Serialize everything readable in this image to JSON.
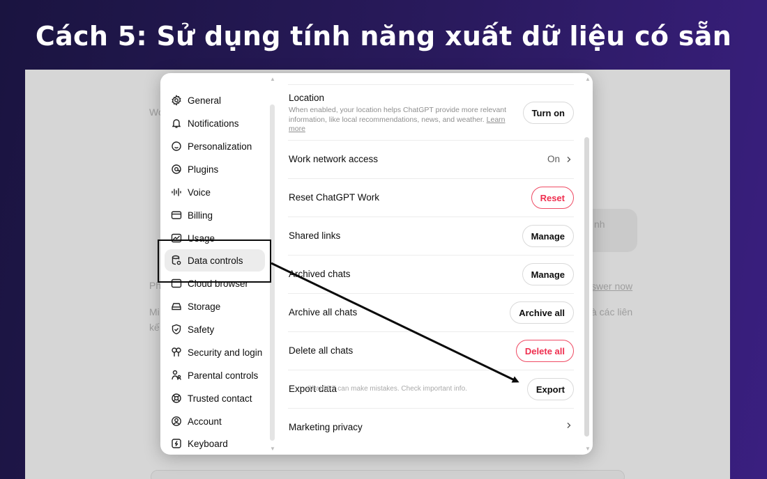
{
  "banner": {
    "title": "Cách 5: Sử dụng tính năng xuất dữ liệu có sẵn"
  },
  "background": {
    "frag_wo": "Wo",
    "frag_ph": "Ph",
    "frag_nh": "nh",
    "frag_answer": "swer now",
    "frag_lien": "à các liên",
    "frag_m": "Mi",
    "frag_ke": "kế",
    "footer_note": "ChatGPT can make mistakes. Check important info."
  },
  "sidebar": {
    "items": [
      {
        "label": "General",
        "icon": "gear-icon"
      },
      {
        "label": "Notifications",
        "icon": "bell-icon"
      },
      {
        "label": "Personalization",
        "icon": "personalization-icon"
      },
      {
        "label": "Plugins",
        "icon": "plugins-icon"
      },
      {
        "label": "Voice",
        "icon": "waveform-icon"
      },
      {
        "label": "Billing",
        "icon": "card-icon"
      },
      {
        "label": "Usage",
        "icon": "usage-chart-icon"
      },
      {
        "label": "Data controls",
        "icon": "database-icon"
      },
      {
        "label": "Cloud browser",
        "icon": "cloud-browser-icon"
      },
      {
        "label": "Storage",
        "icon": "storage-icon"
      },
      {
        "label": "Safety",
        "icon": "shield-icon"
      },
      {
        "label": "Security and login",
        "icon": "key-icon"
      },
      {
        "label": "Parental controls",
        "icon": "parental-icon"
      },
      {
        "label": "Trusted contact",
        "icon": "lifebuoy-icon"
      },
      {
        "label": "Account",
        "icon": "account-icon"
      },
      {
        "label": "Keyboard",
        "icon": "keyboard-icon"
      }
    ],
    "active_item": "Data controls"
  },
  "settings": {
    "location": {
      "label": "Location",
      "description": "When enabled, your location helps ChatGPT provide more relevant information, like local recommendations, news, and weather.",
      "learn_more": "Learn more",
      "button": "Turn on"
    },
    "work_network": {
      "label": "Work network access",
      "value": "On"
    },
    "reset_work": {
      "label": "Reset ChatGPT Work",
      "button": "Reset"
    },
    "shared_links": {
      "label": "Shared links",
      "button": "Manage"
    },
    "archived_chats": {
      "label": "Archived chats",
      "button": "Manage"
    },
    "archive_all": {
      "label": "Archive all chats",
      "button": "Archive all"
    },
    "delete_all": {
      "label": "Delete all chats",
      "button": "Delete all"
    },
    "export_data": {
      "label": "Export data",
      "button": "Export"
    },
    "marketing_privacy": {
      "label": "Marketing privacy"
    }
  },
  "colors": {
    "danger": "#ef2f4f",
    "annotation": "#0a0a0a",
    "banner_bg_start": "#1a1440",
    "banner_bg_end": "#3a1f80"
  }
}
